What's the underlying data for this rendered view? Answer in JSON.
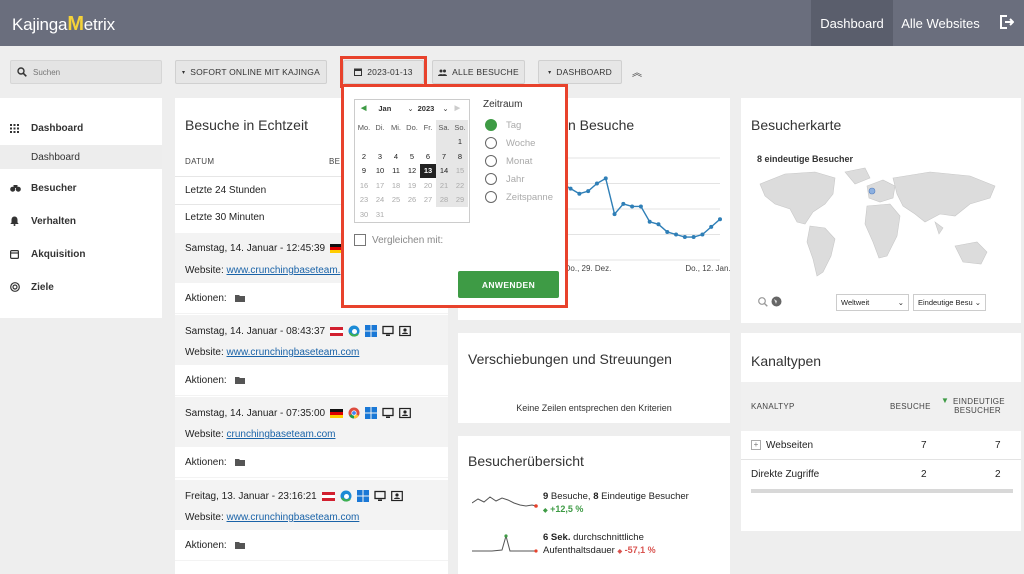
{
  "brand": {
    "prefix": "Kajinga",
    "m": "M",
    "suffix": "etrix"
  },
  "nav": {
    "dashboard": "Dashboard",
    "all_websites": "Alle Websites"
  },
  "search": {
    "placeholder": "Suchen"
  },
  "toolbar": {
    "site_select": "SOFORT ONLINE MIT KAJINGA",
    "date": "2023-01-13",
    "segment": "ALLE BESUCHE",
    "view": "DASHBOARD"
  },
  "sidebar": {
    "items": [
      {
        "label": "Dashboard",
        "icon": "grid-icon"
      },
      {
        "label": "Besucher",
        "icon": "binoculars-icon"
      },
      {
        "label": "Verhalten",
        "icon": "bell-icon"
      },
      {
        "label": "Akquisition",
        "icon": "window-icon"
      },
      {
        "label": "Ziele",
        "icon": "target-icon"
      }
    ],
    "sub_item": "Dashboard"
  },
  "realtime": {
    "title": "Besuche in Echtzeit",
    "col_date": "DATUM",
    "col_visits": "BE",
    "rows": [
      "Letzte 24 Stunden",
      "Letzte 30 Minuten"
    ],
    "visits": [
      {
        "time": "Samstag, 14. Januar - 12:45:39",
        "site_label": "Website:",
        "site": "www.crunchingbaseteam.",
        "actions": "Aktionen:"
      },
      {
        "time": "Samstag, 14. Januar - 08:43:37",
        "site_label": "Website:",
        "site": "www.crunchingbaseteam.com",
        "actions": "Aktionen:"
      },
      {
        "time": "Samstag, 14. Januar - 07:35:00",
        "site_label": "Website:",
        "site": "crunchingbaseteam.com",
        "actions": "Aktionen:"
      },
      {
        "time": "Freitag, 13. Januar - 23:16:21",
        "site_label": "Website:",
        "site": "www.crunchingbaseteam.com",
        "actions": "Aktionen:"
      }
    ]
  },
  "visits_card": {
    "title_visible": "n Besuche",
    "x_labels": [
      "Do., 29. Dez.",
      "Do., 12. Jan."
    ]
  },
  "chart_data": {
    "type": "line",
    "title": "n Besuche",
    "x": [
      "Do., 29. Dez.",
      "Do., 12. Jan."
    ],
    "series": [
      {
        "values": [
          3.2,
          3.0,
          2.8,
          2.6,
          2.7,
          3.0,
          3.2,
          1.8,
          2.2,
          2.1,
          2.1,
          1.5,
          1.4,
          1.1,
          1.0,
          0.9,
          0.9,
          1.0,
          1.3,
          1.6
        ]
      }
    ]
  },
  "besucherkarte": {
    "title": "Besucherkarte",
    "unique": "8 eindeutige Besucher",
    "region": "Weltweit",
    "metric": "Eindeutige Besu"
  },
  "shifts": {
    "title": "Verschiebungen und Streuungen",
    "empty": "Keine Zeilen entsprechen den Kriterien"
  },
  "overview": {
    "title": "Besucherübersicht",
    "l1_a": "9",
    "l1_b": " Besuche, ",
    "l1_c": "8",
    "l1_d": " Eindeutige Besucher",
    "l1_change": "+12,5 %",
    "l2_a": "6 Sek.",
    "l2_b": " durchschnittliche",
    "l2_c": "Aufenthaltsdauer",
    "l2_change": "-57,1 %"
  },
  "channels": {
    "title": "Kanaltypen",
    "col_type": "KANALTYP",
    "col_visits": "BESUCHE",
    "col_unique_1": "EINDEUTIGE",
    "col_unique_2": "BESUCHER",
    "rows": [
      {
        "name": "Webseiten",
        "visits": "7",
        "unique": "7"
      },
      {
        "name": "Direkte Zugriffe",
        "visits": "2",
        "unique": "2"
      }
    ]
  },
  "datepicker": {
    "month": "Jan",
    "year": "2023",
    "weekdays": [
      "Mo.",
      "Di.",
      "Mi.",
      "Do.",
      "Fr.",
      "Sa.",
      "So."
    ],
    "days": [
      "",
      "",
      "",
      "",
      "",
      "",
      "1",
      "2",
      "3",
      "4",
      "5",
      "6",
      "7",
      "8",
      "9",
      "10",
      "11",
      "12",
      "13",
      "14",
      "15",
      "16",
      "17",
      "18",
      "19",
      "20",
      "21",
      "22",
      "23",
      "24",
      "25",
      "26",
      "27",
      "28",
      "29",
      "30",
      "31"
    ],
    "selected": "13",
    "period_title": "Zeitraum",
    "periods": [
      "Tag",
      "Woche",
      "Monat",
      "Jahr",
      "Zeitspanne"
    ],
    "compare": "Vergleichen mit:",
    "apply": "ANWENDEN"
  },
  "colors": {
    "header": "#6a6e7d",
    "accent_green": "#3e9b45",
    "highlight_red": "#e8422c",
    "link_blue": "#1a63a8",
    "line_blue": "#2f7fb7"
  }
}
